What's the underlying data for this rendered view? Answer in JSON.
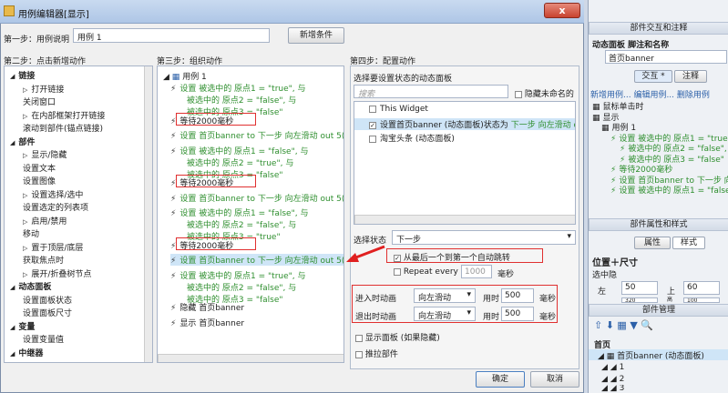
{
  "window": {
    "title": "用例编辑器[显示]",
    "close": "x"
  },
  "step1": {
    "label": "第一步：用例说明",
    "value": "用例 1",
    "add_button": "新增条件"
  },
  "step2": {
    "label": "第二步：点击新增动作",
    "items": [
      {
        "t": "链接",
        "bold": true,
        "indent": 0,
        "arrow": "◢"
      },
      {
        "t": "打开链接",
        "indent": 1,
        "arrow": "▷"
      },
      {
        "t": "关闭窗口",
        "indent": 1
      },
      {
        "t": "在内部框架打开链接",
        "indent": 1,
        "arrow": "▷"
      },
      {
        "t": "滚动到部件(锚点链接)",
        "indent": 1
      },
      {
        "t": "部件",
        "bold": true,
        "indent": 0,
        "arrow": "◢"
      },
      {
        "t": "显示/隐藏",
        "indent": 1,
        "arrow": "▷"
      },
      {
        "t": "设置文本",
        "indent": 1
      },
      {
        "t": "设置图像",
        "indent": 1
      },
      {
        "t": "设置选择/选中",
        "indent": 1,
        "arrow": "▷"
      },
      {
        "t": "设置选定的列表项",
        "indent": 1
      },
      {
        "t": "启用/禁用",
        "indent": 1,
        "arrow": "▷"
      },
      {
        "t": "移动",
        "indent": 1
      },
      {
        "t": "置于顶层/底层",
        "indent": 1,
        "arrow": "▷"
      },
      {
        "t": "获取焦点时",
        "indent": 1
      },
      {
        "t": "展开/折叠树节点",
        "indent": 1,
        "arrow": "▷"
      },
      {
        "t": "动态面板",
        "bold": true,
        "indent": 0,
        "arrow": "◢"
      },
      {
        "t": "设置面板状态",
        "indent": 1
      },
      {
        "t": "设置面板尺寸",
        "indent": 1
      },
      {
        "t": "变量",
        "bold": true,
        "indent": 0,
        "arrow": "◢"
      },
      {
        "t": "设置变量值",
        "indent": 1
      },
      {
        "t": "中继器",
        "bold": true,
        "indent": 0,
        "arrow": "◢"
      }
    ]
  },
  "step3": {
    "label": "第三步：组织动作",
    "case": "用例 1",
    "actions": [
      {
        "type": "set",
        "lines": [
          "设置 被选中的 原点1 = \"true\", 与",
          "被选中的 原点2 = \"false\", 与",
          "被选中的 原点3 = \"false\""
        ]
      },
      {
        "type": "wait",
        "lines": [
          "等待2000毫秒"
        ]
      },
      {
        "type": "set",
        "lines": [
          "设置 首页banner to 下一步 向左滑动 out 5("
        ]
      },
      {
        "type": "set",
        "lines": [
          "设置 被选中的 原点1 = \"false\", 与",
          "被选中的 原点2 = \"true\", 与",
          "被选中的 原点3 = \"false\""
        ]
      },
      {
        "type": "wait",
        "lines": [
          "等待2000毫秒"
        ]
      },
      {
        "type": "set",
        "lines": [
          "设置 首页banner to 下一步 向左滑动 out 5("
        ]
      },
      {
        "type": "set",
        "lines": [
          "设置 被选中的 原点1 = \"false\", 与",
          "被选中的 原点2 = \"false\", 与",
          "被选中的 原点3 = \"true\""
        ]
      },
      {
        "type": "wait",
        "lines": [
          "等待2000毫秒"
        ]
      },
      {
        "type": "set",
        "lines": [
          "设置 首页banner to 下一步 向左滑动 out 5("
        ],
        "selected": true
      },
      {
        "type": "set",
        "lines": [
          "设置 被选中的 原点1 = \"true\", 与",
          "被选中的 原点2 = \"false\", 与",
          "被选中的 原点3 = \"false\""
        ]
      },
      {
        "type": "hide",
        "lines": [
          "隐藏 首页banner"
        ]
      },
      {
        "type": "show",
        "lines": [
          "显示 首页banner"
        ]
      }
    ]
  },
  "step4": {
    "label": "第四步：配置动作",
    "panel_label": "选择要设置状态的动态面板",
    "search_placeholder": "搜索",
    "hide_unnamed": "隐藏未命名的",
    "items": [
      {
        "t": "This Widget",
        "checked": false
      },
      {
        "t": "设置首页banner (动态面板)状态为",
        "suffix": "下一步 向左滑动 out 5(",
        "checked": true
      },
      {
        "t": "淘宝头条 (动态面板)",
        "checked": false
      }
    ],
    "state_label": "选择状态",
    "state_value": "下一步",
    "wrap_label": "从最后一个到第一个自动跳转",
    "repeat_label": "Repeat every",
    "repeat_value": "1000",
    "ms": "毫秒",
    "enter_label": "进入时动画",
    "enter_value": "向左滑动",
    "time_label": "用时",
    "enter_time": "500",
    "exit_label": "退出时动画",
    "exit_value": "向左滑动",
    "exit_time": "500",
    "show_panel": "显示面板 (如果隐藏)",
    "push": "推拉部件"
  },
  "buttons": {
    "ok": "确定",
    "cancel": "取消"
  },
  "right": {
    "title": "部件交互和注释",
    "name_label": "动态面板 脚注和名称",
    "name_value": "首页banner",
    "tab1": "交互 *",
    "tab2": "注释",
    "links": "新增用例... 编辑用例... 删除用例",
    "events": [
      {
        "t": "鼠标单击时",
        "indent": 0
      },
      {
        "t": "显示",
        "indent": 0
      },
      {
        "t": "用例 1",
        "indent": 1
      },
      {
        "t": "设置 被选中的 原点1 = \"true\"",
        "indent": 2
      },
      {
        "t": "被选中的 原点2 = \"false\", 与",
        "indent": 3
      },
      {
        "t": "被选中的 原点3 = \"false\"",
        "indent": 3
      },
      {
        "t": "等待2000毫秒",
        "indent": 2
      },
      {
        "t": "设置 首页banner to 下一步 向",
        "indent": 2
      },
      {
        "t": "设置 被选中的 原点1 = \"false\"",
        "indent": 2
      }
    ],
    "props_title": "部件属性和样式",
    "ptab1": "属性",
    "ptab2": "样式",
    "pos_label": "位置＋尺寸",
    "hidden": "选中隐",
    "x_label": "左",
    "x": "50",
    "y_label": "上",
    "y": "60",
    "w": "320",
    "h_label": "高",
    "h": "100",
    "mgr_title": "部件管理",
    "root": "首页",
    "banner": "首页banner (动态面板)",
    "s1": "1",
    "s2": "2",
    "s3": "3"
  }
}
